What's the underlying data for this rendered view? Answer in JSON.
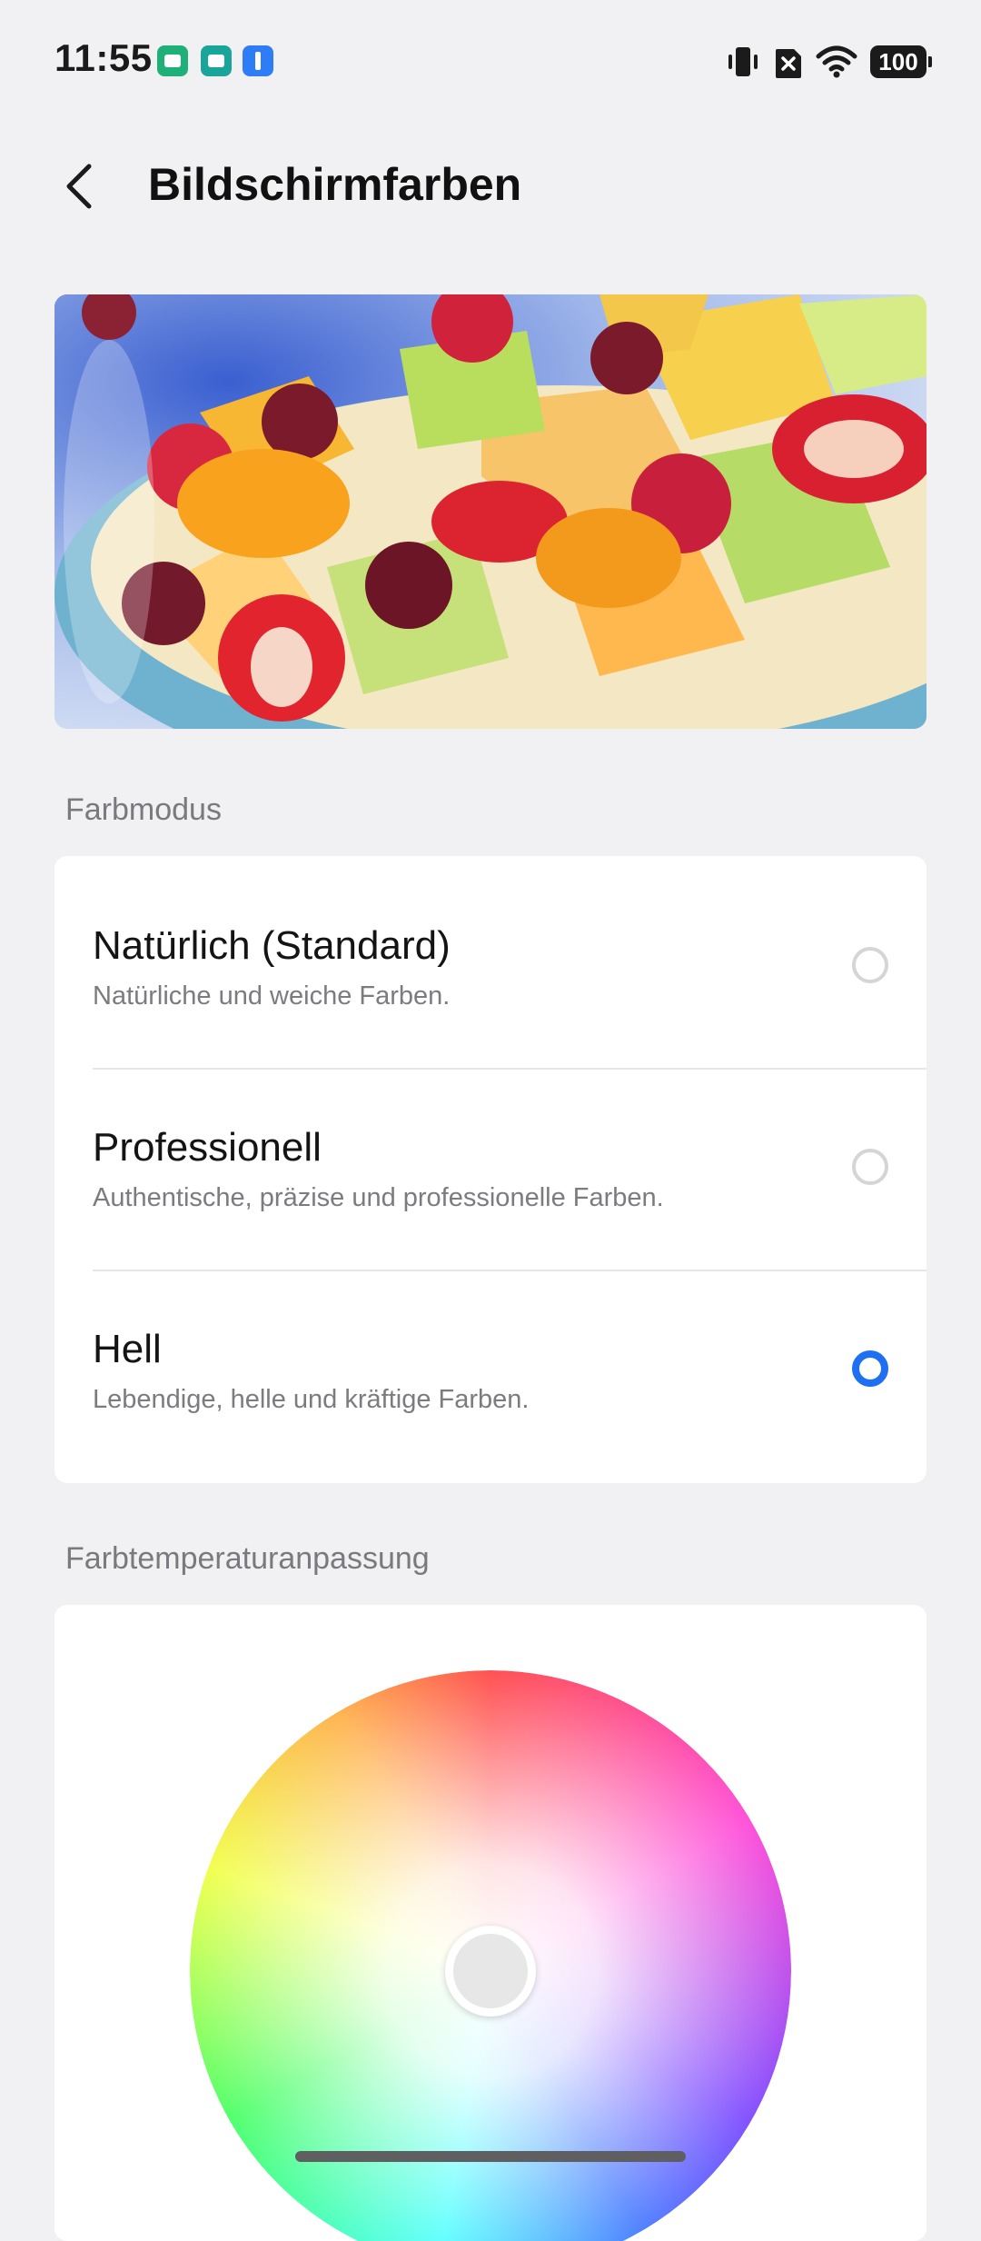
{
  "status_bar": {
    "time": "11:55",
    "battery": "100"
  },
  "header": {
    "title": "Bildschirmfarben"
  },
  "color_mode": {
    "section_label": "Farbmodus",
    "options": [
      {
        "title": "Natürlich (Standard)",
        "description": "Natürliche und weiche Farben.",
        "selected": false
      },
      {
        "title": "Professionell",
        "description": "Authentische, präzise und professionelle Farben.",
        "selected": false
      },
      {
        "title": "Hell",
        "description": "Lebendige, helle und kräftige Farben.",
        "selected": true
      }
    ]
  },
  "color_temperature": {
    "section_label": "Farbtemperaturanpassung"
  },
  "colors": {
    "accent": "#1f6ff2",
    "background": "#f1f1f3",
    "card": "#ffffff"
  }
}
